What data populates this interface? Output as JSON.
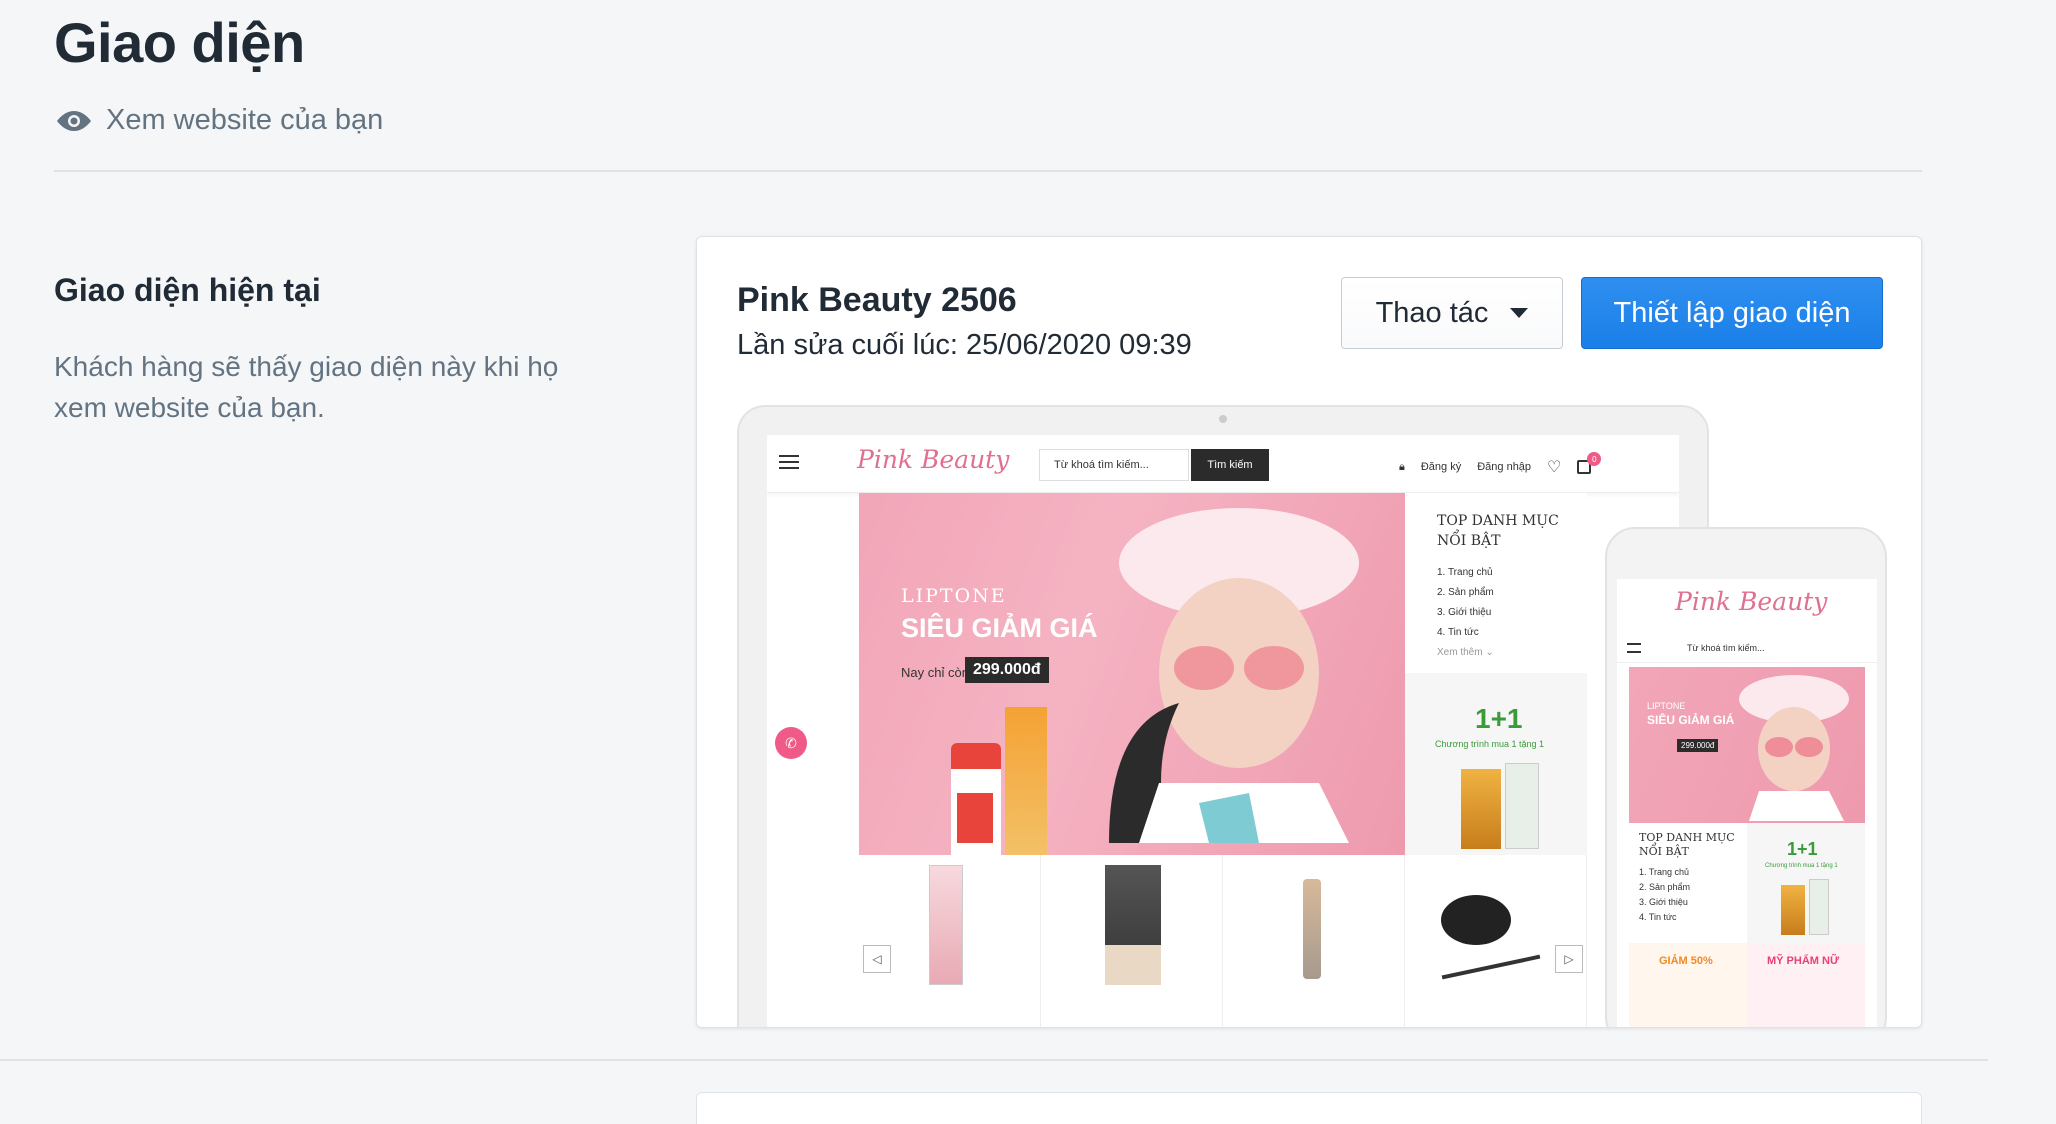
{
  "page": {
    "title": "Giao diện",
    "view_website_label": "Xem website của bạn",
    "view_icon": "eye-icon"
  },
  "current_theme_section": {
    "heading": "Giao diện hiện tại",
    "description": "Khách hàng sẽ thấy giao diện này khi họ xem website của bạn."
  },
  "theme_card": {
    "name": "Pink Beauty 2506",
    "last_edited": "Lần sửa cuối lúc: 25/06/2020 09:39",
    "actions_label": "Thao tác",
    "customize_label": "Thiết lập giao diện",
    "accent_color": "#1f84ea"
  },
  "preview": {
    "logo": "Pink Beauty",
    "search_placeholder": "Từ khoá tìm kiếm...",
    "search_button": "Tìm kiếm",
    "register": "Đăng ký",
    "login": "Đăng nhập",
    "cart_count": "0",
    "hero": {
      "brand": "LIPTONE",
      "sale": "SIÊU GIẢM GIÁ",
      "now_label": "Nay chỉ còn",
      "price": "299.000đ"
    },
    "side_title": "TOP DANH MỤC NỔI BẬT",
    "side_items": [
      "1. Trang chủ",
      "2. Sản phẩm",
      "3. Giới thiệu",
      "4. Tin tức"
    ],
    "side_more": "Xem thêm ⌄",
    "promo_big": "1+1",
    "promo_sub": "Chương trình mua 1 tặng 1",
    "mobile": {
      "search": "Từ khoá tìm kiếm...",
      "side_title": "TOP DANH MỤC NỔI BẬT",
      "sale50": "GIẢM 50%",
      "my_pham": "MỸ PHẨM NỮ"
    }
  }
}
